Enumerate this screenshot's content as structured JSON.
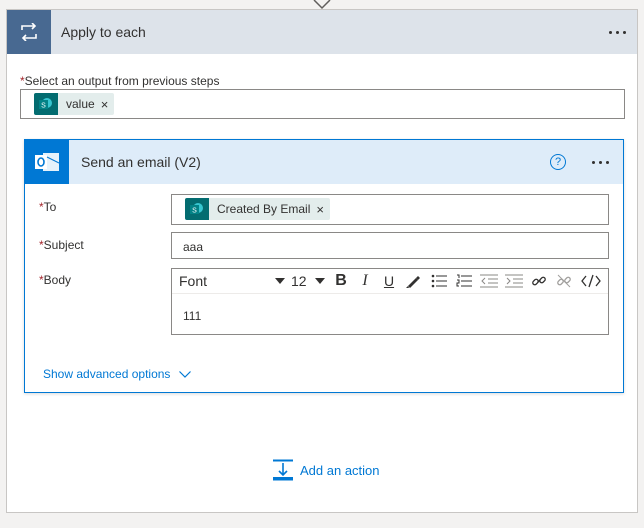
{
  "loop": {
    "title": "Apply to each",
    "output_label": "Select an output from previous steps",
    "output_token": "value"
  },
  "action": {
    "title": "Send an email (V2)",
    "help_glyph": "?",
    "to_label": "To",
    "to_token": "Created By Email",
    "subject_label": "Subject",
    "subject_value": "aaa",
    "body_label": "Body",
    "body_value": "111",
    "toolbar": {
      "font": "Font",
      "size": "12",
      "bold": "B",
      "italic": "I",
      "underline": "U"
    },
    "advanced_label": "Show advanced options"
  },
  "add_action_label": "Add an action",
  "required_mark": "*",
  "token_remove": "×",
  "colors": {
    "loop_icon_bg": "#486991",
    "loop_header_bg": "#dde3ea",
    "action_header_bg": "#deecf9",
    "accent": "#0078d4",
    "sharepoint": "#036c70",
    "required": "#a4262c"
  },
  "icons": [
    "loop-icon",
    "more-icon",
    "sharepoint-icon",
    "outlook-icon",
    "help-icon",
    "chevron-down-icon",
    "add-action-icon"
  ]
}
